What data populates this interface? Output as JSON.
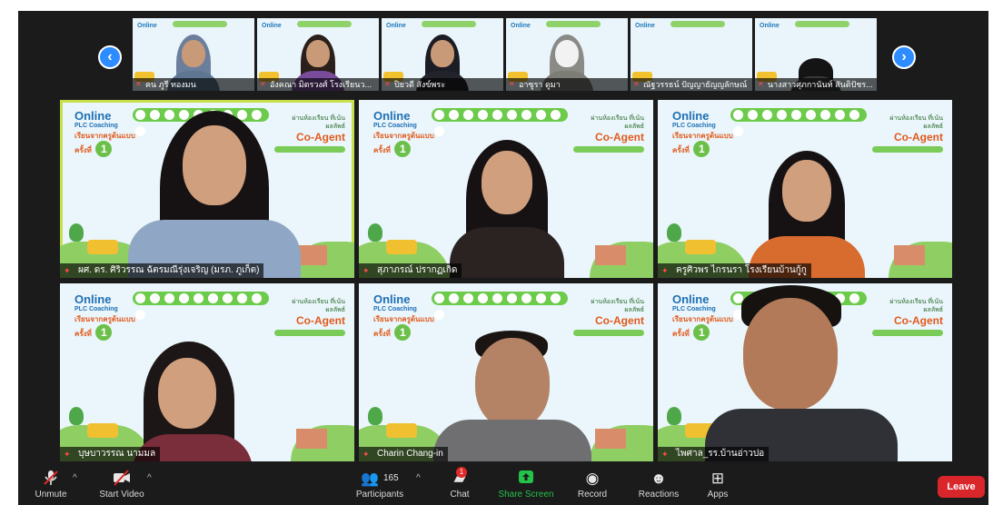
{
  "strip": {
    "prev_icon": "chevron-left-icon",
    "next_icon": "chevron-right-icon",
    "thumbnails": [
      {
        "name": "คน ภูรี ทองมน"
      },
      {
        "name": "อังคณา มิตรวงศ์ โรงเรียนว..."
      },
      {
        "name": "ปิยวดี สังข์พระ"
      },
      {
        "name": "อาซูรา ดูมา"
      },
      {
        "name": "ณัฐวรรธน์ ปัญญาธัญญลักษณ์"
      },
      {
        "name": "นางสาวศุภกานันท์ สันติปัชร..."
      }
    ]
  },
  "grid": {
    "background_title": {
      "line1": "Online",
      "line2": "PLC Coaching",
      "thai": "เรียนจากครูต้นแบบ",
      "count_word": "ครั้งที่",
      "count": "1"
    },
    "background_right": {
      "thai": "ผ่านห้องเรียน ที่เน้นผลลัพธ์",
      "brand": "Co-Agent"
    },
    "tiles": [
      {
        "name": "ผศ. ดร. ศิริวรรณ ฉัตรมณีรุ่งเจริญ (มรภ. ภูเก็ต)"
      },
      {
        "name": "สุภาภรณ์ ปรากฏเกิด"
      },
      {
        "name": "ครูศิวพร ไกรนรา โรงเรียนบ้านกู้กู"
      },
      {
        "name": "บุษบาวรรณ นามมล"
      },
      {
        "name": "Charin Chang-in"
      },
      {
        "name": "ไพศาล_รร.บ้านอ่าวปอ"
      }
    ]
  },
  "toolbar": {
    "unmute": "Unmute",
    "start_video": "Start Video",
    "participants": "Participants",
    "participant_count": "165",
    "chat": "Chat",
    "chat_badge": "1",
    "share_screen": "Share Screen",
    "record": "Record",
    "reactions": "Reactions",
    "apps": "Apps",
    "leave": "Leave"
  },
  "colors": {
    "active_speaker": "#c5e04a",
    "share_green": "#25c24a",
    "leave_red": "#d9262b",
    "nav_blue": "#2d8cff"
  }
}
